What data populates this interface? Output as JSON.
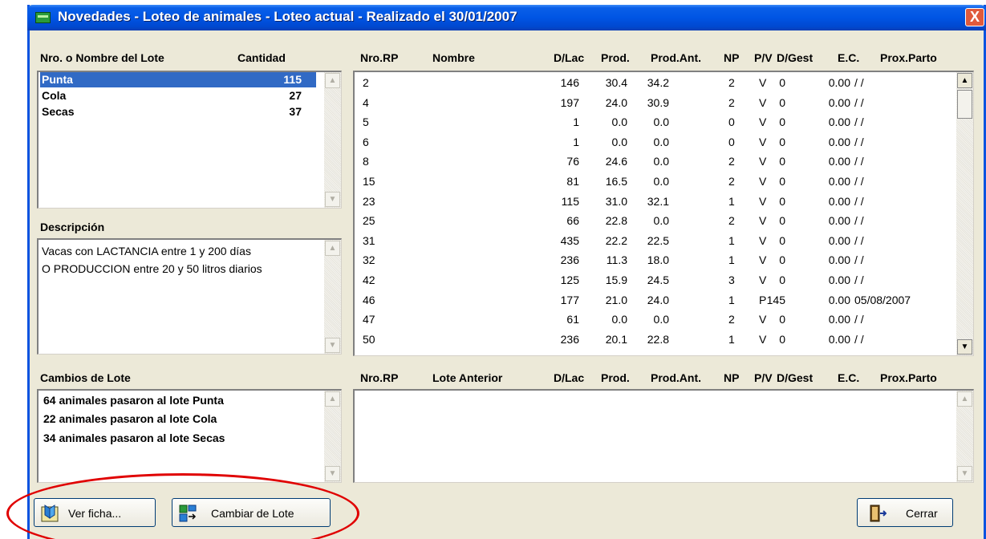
{
  "window": {
    "title": "Novedades - Loteo de animales - Loteo actual - Realizado el 30/01/2007",
    "close_label": "X"
  },
  "lotes": {
    "header_name": "Nro. o Nombre del Lote",
    "header_qty": "Cantidad",
    "items": [
      {
        "name": "Punta",
        "qty": "115",
        "selected": true
      },
      {
        "name": "Cola",
        "qty": "27",
        "selected": false
      },
      {
        "name": "Secas",
        "qty": "37",
        "selected": false
      }
    ]
  },
  "descripcion": {
    "label": "Descripción",
    "lines": [
      "Vacas con LACTANCIA entre 1 y 200 días",
      "O PRODUCCION entre 20 y 50 litros diarios"
    ]
  },
  "cambios": {
    "label": "Cambios de Lote",
    "lines": [
      "64 animales pasaron al lote Punta",
      "22 animales pasaron al lote Cola",
      "34 animales pasaron al lote Secas"
    ]
  },
  "animals": {
    "columns": [
      "Nro.RP",
      "Nombre",
      "D/Lac",
      "Prod.",
      "Prod.Ant.",
      "NP",
      "P/V",
      "D/Gest",
      "E.C.",
      "Prox.Parto"
    ],
    "rows": [
      [
        "2",
        "",
        "146",
        "30.4",
        "34.2",
        "2",
        "V",
        "0",
        "0.00",
        "/ /"
      ],
      [
        "4",
        "",
        "197",
        "24.0",
        "30.9",
        "2",
        "V",
        "0",
        "0.00",
        "/ /"
      ],
      [
        "5",
        "",
        "1",
        "0.0",
        "0.0",
        "0",
        "V",
        "0",
        "0.00",
        "/ /"
      ],
      [
        "6",
        "",
        "1",
        "0.0",
        "0.0",
        "0",
        "V",
        "0",
        "0.00",
        "/ /"
      ],
      [
        "8",
        "",
        "76",
        "24.6",
        "0.0",
        "2",
        "V",
        "0",
        "0.00",
        "/ /"
      ],
      [
        "15",
        "",
        "81",
        "16.5",
        "0.0",
        "2",
        "V",
        "0",
        "0.00",
        "/ /"
      ],
      [
        "23",
        "",
        "115",
        "31.0",
        "32.1",
        "1",
        "V",
        "0",
        "0.00",
        "/ /"
      ],
      [
        "25",
        "",
        "66",
        "22.8",
        "0.0",
        "2",
        "V",
        "0",
        "0.00",
        "/ /"
      ],
      [
        "31",
        "",
        "435",
        "22.2",
        "22.5",
        "1",
        "V",
        "0",
        "0.00",
        "/ /"
      ],
      [
        "32",
        "",
        "236",
        "11.3",
        "18.0",
        "1",
        "V",
        "0",
        "0.00",
        "/ /"
      ],
      [
        "42",
        "",
        "125",
        "15.9",
        "24.5",
        "3",
        "V",
        "0",
        "0.00",
        "/ /"
      ],
      [
        "46",
        "",
        "177",
        "21.0",
        "24.0",
        "1",
        "P",
        "145",
        "0.00",
        "05/08/2007"
      ],
      [
        "47",
        "",
        "61",
        "0.0",
        "0.0",
        "2",
        "V",
        "0",
        "0.00",
        "/ /"
      ],
      [
        "50",
        "",
        "236",
        "20.1",
        "22.8",
        "1",
        "V",
        "0",
        "0.00",
        "/ /"
      ]
    ]
  },
  "changes_table": {
    "columns": [
      "Nro.RP",
      "Lote Anterior",
      "D/Lac",
      "Prod.",
      "Prod.Ant.",
      "NP",
      "P/V",
      "D/Gest",
      "E.C.",
      "Prox.Parto"
    ]
  },
  "buttons": {
    "ver_ficha": "Ver ficha...",
    "cambiar_lote": "Cambiar de Lote",
    "cerrar": "Cerrar"
  },
  "colors": {
    "title_bar": "#0055e4",
    "selection": "#316ac5",
    "highlight_circle": "#e00000"
  }
}
